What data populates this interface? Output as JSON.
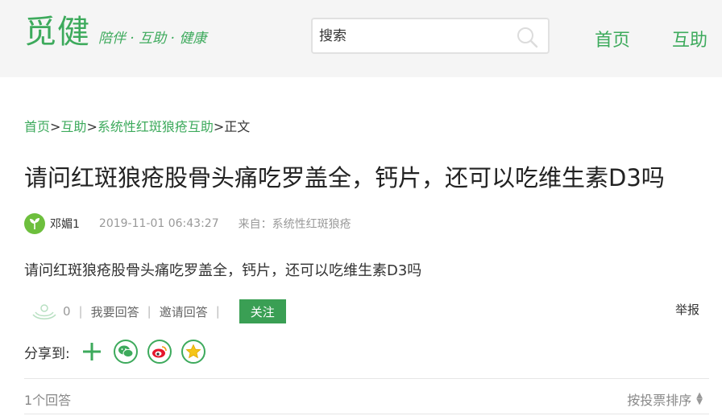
{
  "header": {
    "logo_text": "觅健",
    "slogan": "陪伴 · 互助 · 健康",
    "search_placeholder": "搜索",
    "nav": {
      "home": "首页",
      "help": "互助"
    }
  },
  "breadcrumb": {
    "home": "首页",
    "sep": ">",
    "help": "互助",
    "group": "系统性红斑狼疮互助",
    "current": "正文"
  },
  "post": {
    "title": "请问红斑狼疮股骨头痛吃罗盖全，钙片，还可以吃维生素D3吗",
    "author": "邓媚1",
    "date": "2019-11-01 06:43:27",
    "from_label": "来自：",
    "from_value": "系统性红斑狼疮",
    "body": "请问红斑狼疮股骨头痛吃罗盖全，钙片，还可以吃维生素D3吗"
  },
  "actions": {
    "like_count": "0",
    "answer": "我要回答",
    "invite": "邀请回答",
    "follow": "关注",
    "report": "举报",
    "sep": "|"
  },
  "share": {
    "label": "分享到:",
    "targets": [
      "plus-icon",
      "wechat-icon",
      "weibo-icon",
      "qzone-icon"
    ]
  },
  "answers": {
    "count_text": "1个回答",
    "sort_text": "按投票排序"
  },
  "colors": {
    "brand": "#3daa5c",
    "follow_button": "#3a9f54",
    "header_bg": "#f5f5f5"
  }
}
